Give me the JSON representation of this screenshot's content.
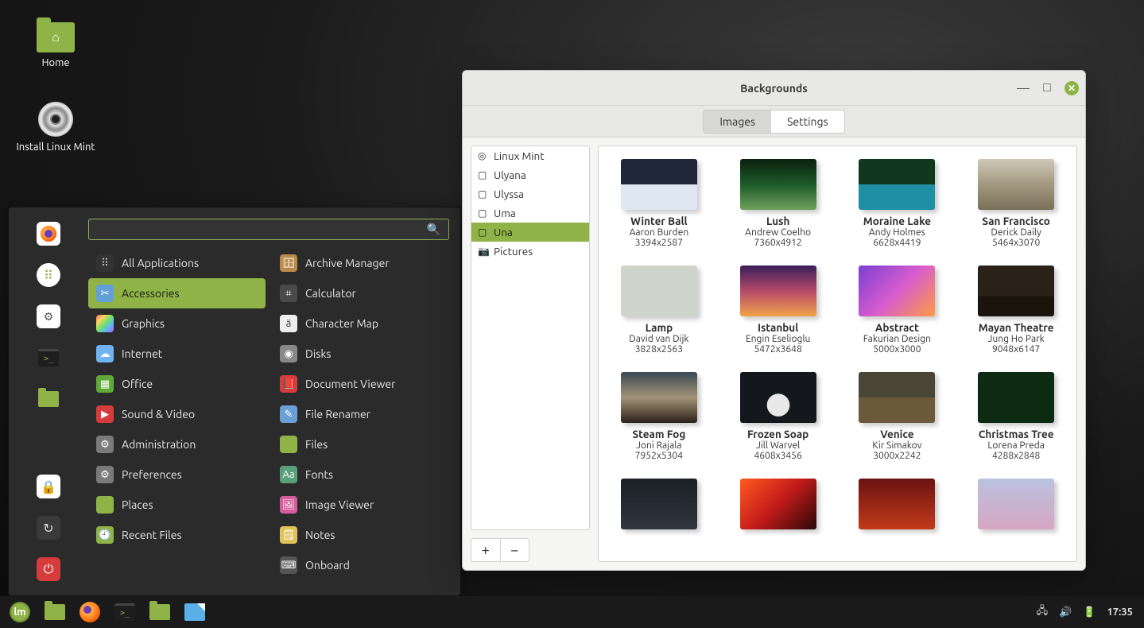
{
  "desktop": {
    "home": "Home",
    "install": "Install Linux Mint"
  },
  "menu": {
    "search_placeholder": "",
    "sidebar": [
      {
        "name": "firefox",
        "kind": "ff"
      },
      {
        "name": "software",
        "kind": "grid-green"
      },
      {
        "name": "settings",
        "kind": "toggles"
      },
      {
        "name": "terminal",
        "kind": "term"
      },
      {
        "name": "files",
        "kind": "folder"
      },
      {
        "name": "lock",
        "kind": "lock"
      },
      {
        "name": "logout",
        "kind": "logout"
      },
      {
        "name": "shutdown",
        "kind": "power"
      }
    ],
    "categories": [
      {
        "label": "All Applications",
        "icon": "grid"
      },
      {
        "label": "Accessories",
        "icon": "scissors",
        "selected": true
      },
      {
        "label": "Graphics",
        "icon": "graphics"
      },
      {
        "label": "Internet",
        "icon": "internet"
      },
      {
        "label": "Office",
        "icon": "office"
      },
      {
        "label": "Sound & Video",
        "icon": "sound"
      },
      {
        "label": "Administration",
        "icon": "admin"
      },
      {
        "label": "Preferences",
        "icon": "pref"
      },
      {
        "label": "Places",
        "icon": "places"
      },
      {
        "label": "Recent Files",
        "icon": "recent"
      }
    ],
    "apps": [
      {
        "label": "Archive Manager",
        "icon": "archive"
      },
      {
        "label": "Calculator",
        "icon": "calc"
      },
      {
        "label": "Character Map",
        "icon": "char"
      },
      {
        "label": "Disks",
        "icon": "disks"
      },
      {
        "label": "Document Viewer",
        "icon": "doc"
      },
      {
        "label": "File Renamer",
        "icon": "renamer"
      },
      {
        "label": "Files",
        "icon": "files"
      },
      {
        "label": "Fonts",
        "icon": "fonts"
      },
      {
        "label": "Image Viewer",
        "icon": "image"
      },
      {
        "label": "Notes",
        "icon": "notes"
      },
      {
        "label": "Onboard",
        "icon": "onboard"
      }
    ]
  },
  "bgwin": {
    "title": "Backgrounds",
    "tabs": {
      "images": "Images",
      "settings": "Settings",
      "active": "images"
    },
    "collections": [
      {
        "label": "Linux Mint",
        "icon": "mint"
      },
      {
        "label": "Ulyana",
        "icon": "pic"
      },
      {
        "label": "Ulyssa",
        "icon": "pic"
      },
      {
        "label": "Uma",
        "icon": "pic"
      },
      {
        "label": "Una",
        "icon": "pic",
        "selected": true
      },
      {
        "label": "Pictures",
        "icon": "cam"
      }
    ],
    "add": "+",
    "remove": "−",
    "wallpapers": [
      {
        "name": "Winter Ball",
        "author": "Aaron Burden",
        "dim": "3394x2587",
        "th": "th1"
      },
      {
        "name": "Lush",
        "author": "Andrew Coelho",
        "dim": "7360x4912",
        "th": "th2"
      },
      {
        "name": "Moraine Lake",
        "author": "Andy Holmes",
        "dim": "6628x4419",
        "th": "th3"
      },
      {
        "name": "San Francisco",
        "author": "Derick Daily",
        "dim": "5464x3070",
        "th": "th4"
      },
      {
        "name": "Lamp",
        "author": "David van Dijk",
        "dim": "3828x2563",
        "th": "th5"
      },
      {
        "name": "Istanbul",
        "author": "Engin Eselioglu",
        "dim": "5472x3648",
        "th": "th6"
      },
      {
        "name": "Abstract",
        "author": "Fakurian Design",
        "dim": "5000x3000",
        "th": "th7"
      },
      {
        "name": "Mayan Theatre",
        "author": "Jung Ho Park",
        "dim": "9048x6147",
        "th": "th8"
      },
      {
        "name": "Steam Fog",
        "author": "Joni Rajala",
        "dim": "7952x5304",
        "th": "th9"
      },
      {
        "name": "Frozen Soap",
        "author": "Jill Warvel",
        "dim": "4608x3456",
        "th": "th10"
      },
      {
        "name": "Venice",
        "author": "Kir Simakov",
        "dim": "3000x2242",
        "th": "th11"
      },
      {
        "name": "Christmas Tree",
        "author": "Lorena Preda",
        "dim": "4288x2848",
        "th": "th12"
      },
      {
        "name": "",
        "author": "",
        "dim": "",
        "th": "th13"
      },
      {
        "name": "",
        "author": "",
        "dim": "",
        "th": "th14"
      },
      {
        "name": "",
        "author": "",
        "dim": "",
        "th": "th15"
      },
      {
        "name": "",
        "author": "",
        "dim": "",
        "th": "th16"
      }
    ]
  },
  "taskbar": {
    "clock": "17:35"
  }
}
